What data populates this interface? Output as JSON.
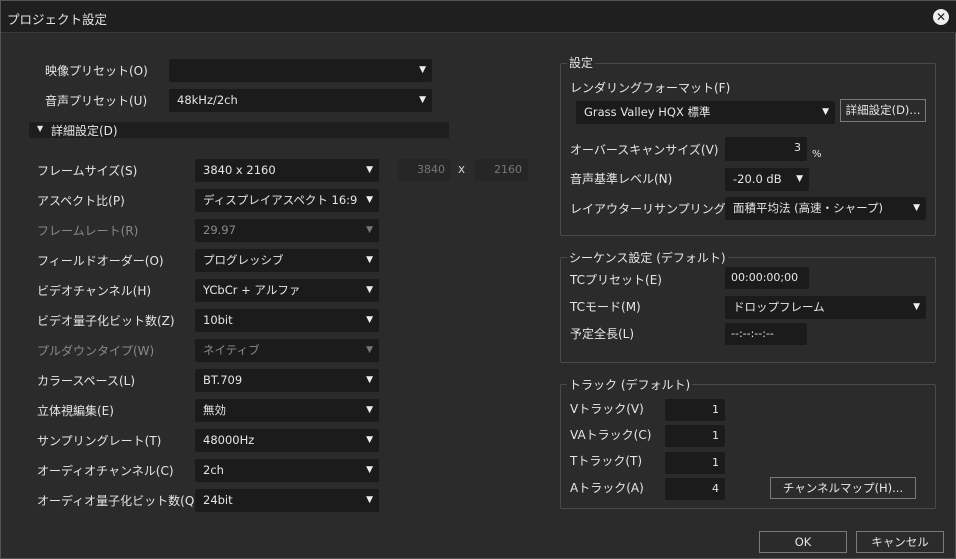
{
  "window": {
    "title": "プロジェクト設定",
    "close_icon": "close-circle-icon"
  },
  "presets": {
    "video_label": "映像プリセット(O)",
    "video_value": "",
    "audio_label": "音声プリセット(U)",
    "audio_value": "48kHz/2ch"
  },
  "detail": {
    "label": "詳細設定(D)"
  },
  "rows": [
    {
      "label": "フレームサイズ(S)",
      "value": "3840 x 2160",
      "disabled": false
    },
    {
      "label": "アスペクト比(P)",
      "value": "ディスプレイアスペクト 16:9",
      "disabled": false
    },
    {
      "label": "フレームレート(R)",
      "value": "29.97",
      "disabled": true
    },
    {
      "label": "フィールドオーダー(O)",
      "value": "プログレッシブ",
      "disabled": false
    },
    {
      "label": "ビデオチャンネル(H)",
      "value": "YCbCr + アルファ",
      "disabled": false
    },
    {
      "label": "ビデオ量子化ビット数(Z)",
      "value": "10bit",
      "disabled": false
    },
    {
      "label": "プルダウンタイプ(W)",
      "value": "ネイティブ",
      "disabled": true
    },
    {
      "label": "カラースペース(L)",
      "value": "BT.709",
      "disabled": false
    },
    {
      "label": "立体視編集(E)",
      "value": "無効",
      "disabled": false
    },
    {
      "label": "サンプリングレート(T)",
      "value": "48000Hz",
      "disabled": false
    },
    {
      "label": "オーディオチャンネル(C)",
      "value": "2ch",
      "disabled": false
    },
    {
      "label": "オーディオ量子化ビット数(Q)",
      "value": "24bit",
      "disabled": false
    }
  ],
  "frame_size": {
    "width": "3840",
    "x": "x",
    "height": "2160"
  },
  "settings": {
    "title": "設定",
    "render_label": "レンダリングフォーマット(F)",
    "render_value": "Grass Valley HQX 標準",
    "detail_button": "詳細設定(D)...",
    "overscan_label": "オーバースキャンサイズ(V)",
    "overscan_value": "3",
    "overscan_unit": "%",
    "audio_level_label": "音声基準レベル(N)",
    "audio_level_value": "-20.0 dB",
    "resample_label": "レイアウターリサンプリング法(R)",
    "resample_value": "面積平均法 (高速・シャープ)"
  },
  "sequence": {
    "title": "シーケンス設定 (デフォルト)",
    "tc_preset_label": "TCプリセット(E)",
    "tc_preset_value": "00:00:00;00",
    "tc_mode_label": "TCモード(M)",
    "tc_mode_value": "ドロップフレーム",
    "duration_label": "予定全長(L)",
    "duration_value": "--:--:--:--"
  },
  "tracks": {
    "title": "トラック (デフォルト)",
    "v_label": "Vトラック(V)",
    "v_value": "1",
    "va_label": "VAトラック(C)",
    "va_value": "1",
    "t_label": "Tトラック(T)",
    "t_value": "1",
    "a_label": "Aトラック(A)",
    "a_value": "4",
    "channel_map_button": "チャンネルマップ(H)..."
  },
  "footer": {
    "ok": "OK",
    "cancel": "キャンセル"
  }
}
